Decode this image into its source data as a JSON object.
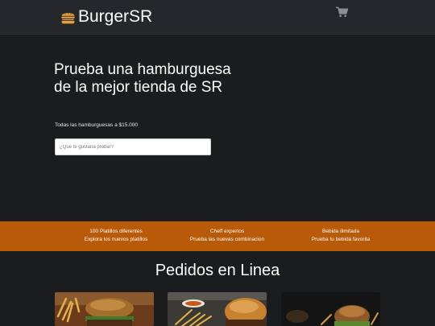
{
  "navbar": {
    "brand_name": "BurgerSR",
    "brand_logo_icon": "burger-icon",
    "cart_icon": "shopping-cart-icon"
  },
  "hero": {
    "title": "Prueba una hamburguesa de la mejor tienda de SR",
    "subtitle": "Todas las hamburguesas a $15.000",
    "search_placeholder": "¿Que te gustaria probar?",
    "search_value": ""
  },
  "features": [
    {
      "title": "100 Platillos diferentes",
      "subtitle": "Explora los nuevos platillos"
    },
    {
      "title": "Cheff expertos",
      "subtitle": "Prueba las nuevas combinacion"
    },
    {
      "title": "Bebida ilimitada",
      "subtitle": "Prueba tu bebida favorita"
    }
  ],
  "orders": {
    "title": "Pedidos en Linea",
    "cards": [
      {
        "image": "burger-with-fries-photo"
      },
      {
        "image": "burger-with-fries-and-sauce-photo"
      },
      {
        "image": "burger-on-dark-table-photo"
      }
    ]
  },
  "colors": {
    "background": "#1b1c1e",
    "navbar": "#26272a",
    "accent_band": "#b85a07",
    "brand_icon": "#e8a13a"
  }
}
